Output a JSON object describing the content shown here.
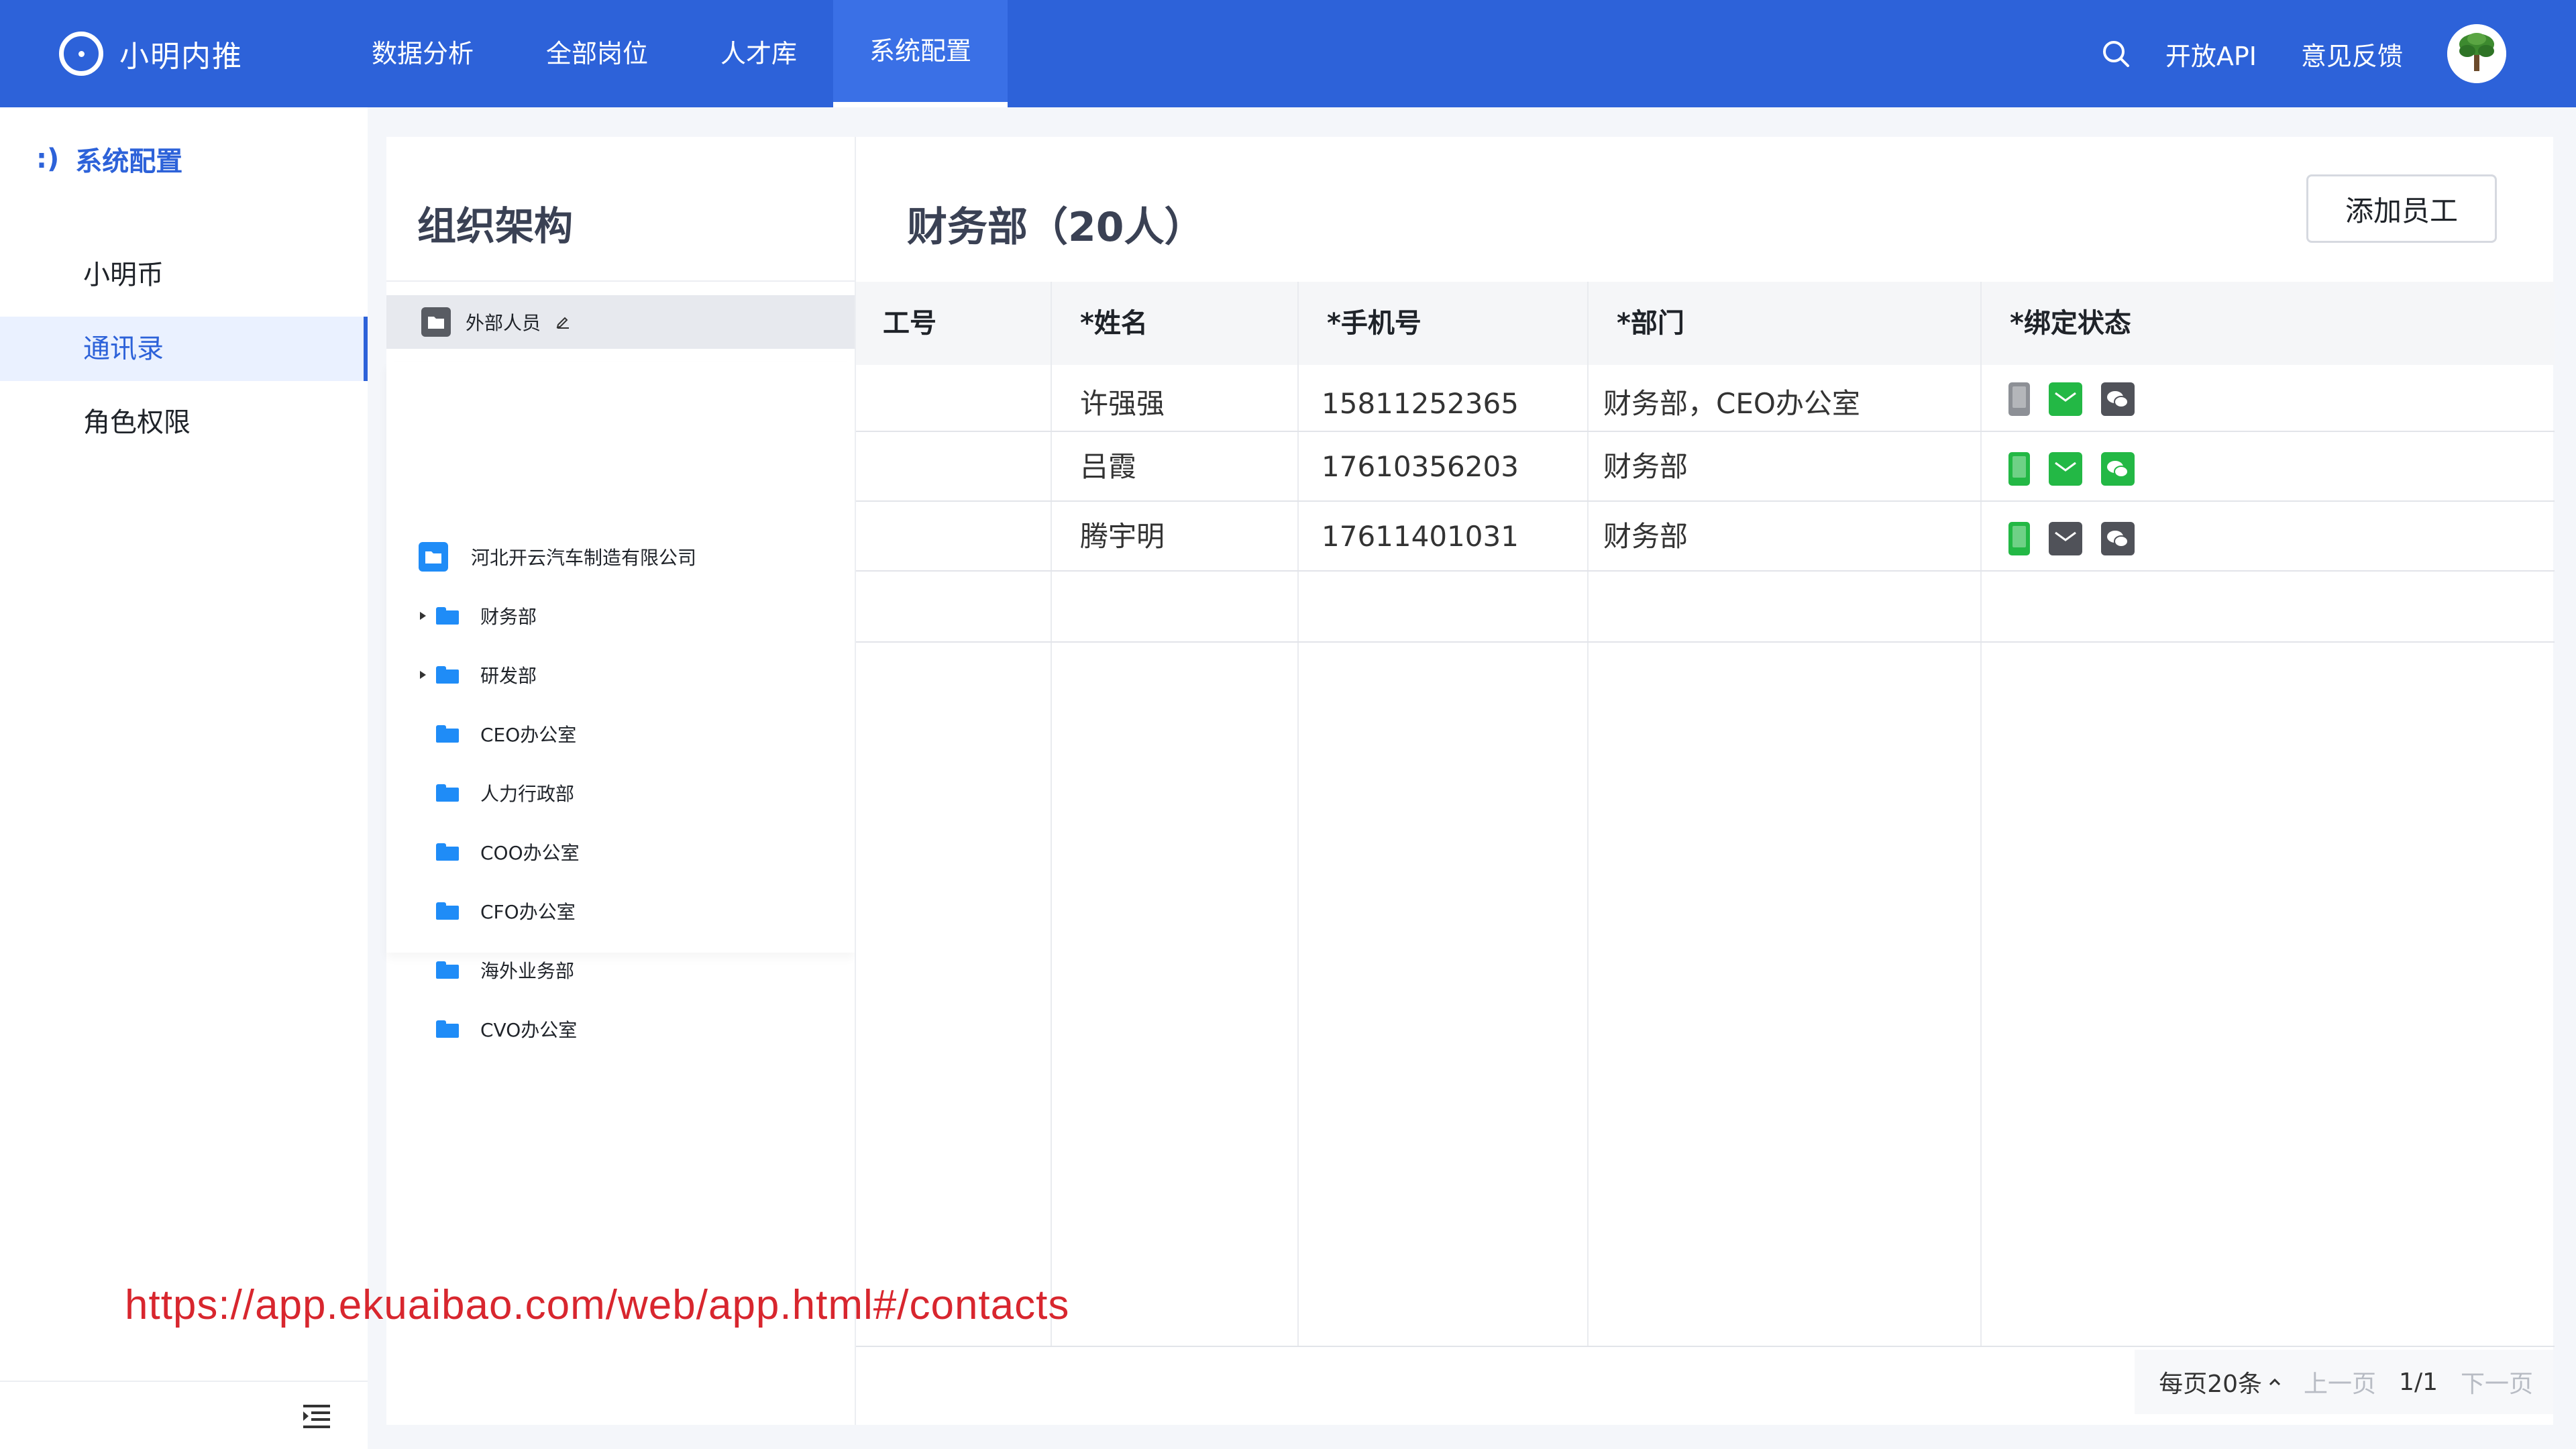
{
  "app": {
    "logo_text": "小明内推"
  },
  "nav": {
    "items": [
      {
        "label": "数据分析"
      },
      {
        "label": "全部岗位"
      },
      {
        "label": "人才库"
      },
      {
        "label": "系统配置"
      }
    ],
    "active_index": 3
  },
  "top_right": {
    "api_label": "开放API",
    "feedback_label": "意见反馈"
  },
  "sidebar": {
    "header_icon": ":)",
    "header_label": "系统配置",
    "items": [
      {
        "label": "小明币"
      },
      {
        "label": "通讯录"
      },
      {
        "label": "角色权限"
      }
    ],
    "active_index": 1
  },
  "org": {
    "title": "组织架构",
    "external_label": "外部人员",
    "root_label": "河北开云汽车制造有限公司",
    "departments": [
      {
        "label": "财务部",
        "expandable": true
      },
      {
        "label": "研发部",
        "expandable": true
      },
      {
        "label": "CEO办公室",
        "expandable": false
      },
      {
        "label": "人力行政部",
        "expandable": false
      },
      {
        "label": "COO办公室",
        "expandable": false
      },
      {
        "label": "CFO办公室",
        "expandable": false
      },
      {
        "label": "海外业务部",
        "expandable": false
      },
      {
        "label": "CVO办公室",
        "expandable": false
      }
    ]
  },
  "main": {
    "title": "财务部（20人）",
    "add_button": "添加员工",
    "columns": [
      "工号",
      "*姓名",
      "*手机号",
      "*部门",
      "*绑定状态"
    ],
    "rows": [
      {
        "id": "",
        "name": "许强强",
        "phone": "15811252365",
        "dept": "财务部，CEO办公室",
        "phone_bound": false,
        "email_bound": true,
        "wechat_bound": false
      },
      {
        "id": "",
        "name": "吕霞",
        "phone": "17610356203",
        "dept": "财务部",
        "phone_bound": true,
        "email_bound": true,
        "wechat_bound": true
      },
      {
        "id": "",
        "name": "腾宇明",
        "phone": "17611401031",
        "dept": "财务部",
        "phone_bound": true,
        "email_bound": false,
        "wechat_bound": false
      }
    ]
  },
  "pager": {
    "per_page": "每页20条",
    "prev": "上一页",
    "page": "1/1",
    "next": "下一页"
  },
  "overlay_url": "https://app.ekuaibao.com/web/app.html#/contacts",
  "colors": {
    "brand": "#2d62d9",
    "bound_green": "#23b845",
    "unbound_dark": "#505259",
    "folder_blue": "#1f8cf7",
    "url_red": "#d8262e"
  }
}
